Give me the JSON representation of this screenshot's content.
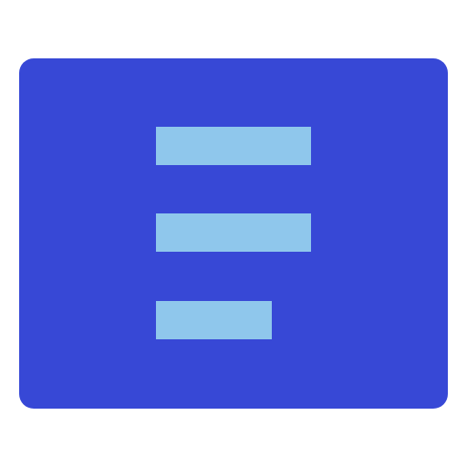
{
  "icon": {
    "name": "text-lines-icon",
    "colors": {
      "background": "#ffffff",
      "tile": "#3748d6",
      "bars": "#8fc7ec"
    }
  }
}
